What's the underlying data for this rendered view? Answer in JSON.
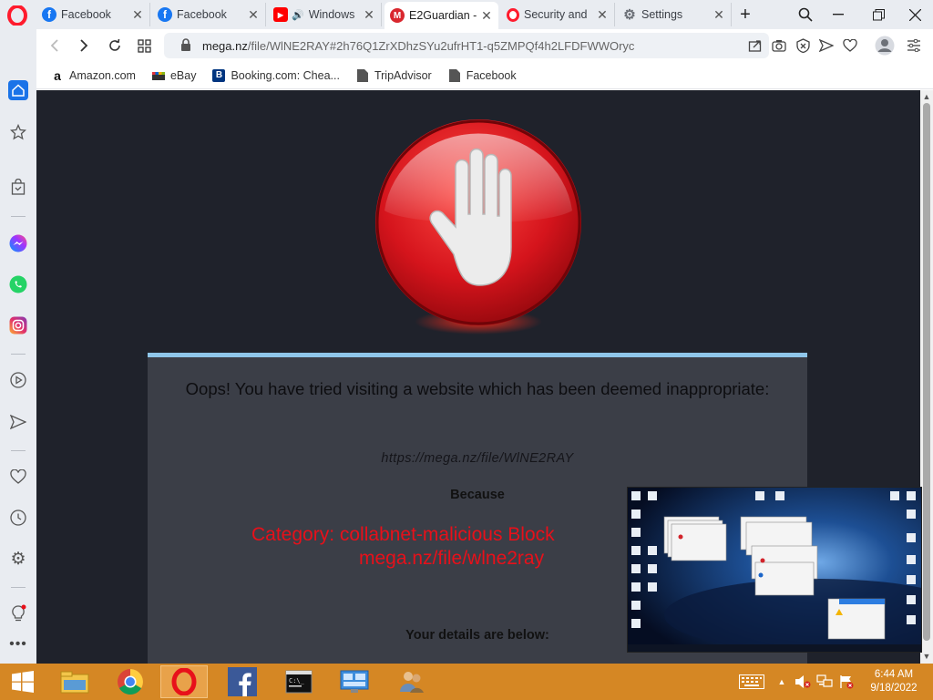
{
  "tabs": [
    {
      "label": "Facebook",
      "icon": "facebook-icon",
      "color": "#1877f2",
      "active": false
    },
    {
      "label": "Facebook",
      "icon": "facebook-icon",
      "color": "#1877f2",
      "active": false
    },
    {
      "label": "Windows",
      "icon": "youtube-icon",
      "color": "#ff0000",
      "active": false
    },
    {
      "label": "E2Guardian -",
      "icon": "mega-icon",
      "color": "#d9272e",
      "active": true
    },
    {
      "label": "Security and",
      "icon": "opera-icon",
      "color": "#ff1b2d",
      "active": false
    },
    {
      "label": "Settings",
      "icon": "gear-icon",
      "color": "#6b6f76",
      "active": false
    }
  ],
  "address": {
    "host": "mega.nz",
    "path": "/file/WlNE2RAY#2h76Q1ZrXDhzSYu2ufrHT1-q5ZMPQf4h2LFDFWWOryc"
  },
  "bookmarks": [
    {
      "label": "Amazon.com",
      "icon": "amazon-icon"
    },
    {
      "label": "eBay",
      "icon": "ebay-icon"
    },
    {
      "label": "Booking.com: Chea...",
      "icon": "booking-icon"
    },
    {
      "label": "TripAdvisor",
      "icon": "page-icon"
    },
    {
      "label": "Facebook",
      "icon": "page-icon"
    }
  ],
  "block_page": {
    "heading": "Oops! You have tried visiting a website which has been deemed inappropriate:",
    "blocked_url": "https://mega.nz/file/WlNE2RAY",
    "because_label": "Because",
    "category_line1": "Category: collabnet-malicious  Block",
    "category_line2": "mega.nz/file/wlne2ray",
    "details_label": "Your details are below:"
  },
  "clock": {
    "time": "6:44 AM",
    "date": "9/18/2022"
  },
  "colors": {
    "accent": "#e8101a",
    "panel_top": "#8fc6ea",
    "taskbar": "#d58724",
    "page_bg": "#1f222b"
  }
}
